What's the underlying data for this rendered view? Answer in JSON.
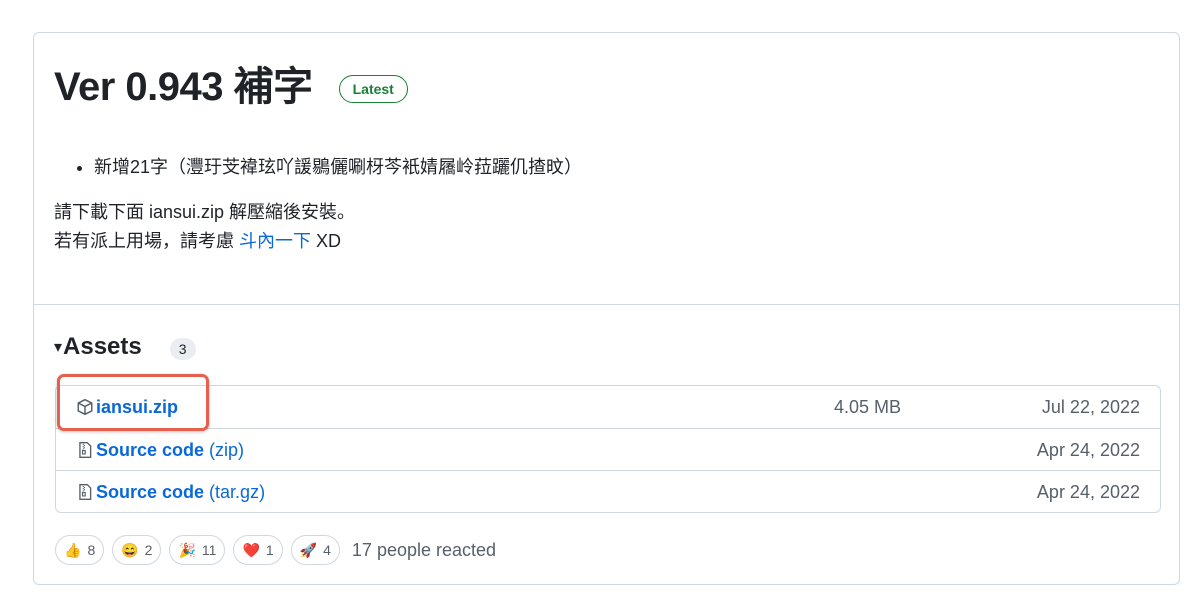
{
  "release": {
    "title": "Ver 0.943 補字",
    "badge": "Latest",
    "bullet": "新增21字（灃玗芠褘玹吖諼鶍儷唰枒芩衹婧屩岭菈躧仉揸旼）",
    "line1": "請下載下面 iansui.zip 解壓縮後安裝。",
    "line2_prefix": "若有派上用場，請考慮 ",
    "line2_link": "斗內一下",
    "line2_suffix": " XD"
  },
  "assets": {
    "title": "Assets",
    "count": "3",
    "items": [
      {
        "name": "iansui.zip",
        "suffix": "",
        "size": "4.05 MB",
        "date": "Jul 22, 2022",
        "icon": "package-icon"
      },
      {
        "name": "Source code",
        "suffix": "(zip)",
        "size": "",
        "date": "Apr 24, 2022",
        "icon": "file-zip-icon"
      },
      {
        "name": "Source code",
        "suffix": "(tar.gz)",
        "size": "",
        "date": "Apr 24, 2022",
        "icon": "file-zip-icon"
      }
    ]
  },
  "reactions": {
    "items": [
      {
        "emoji": "👍",
        "count": "8",
        "icon": "thumbs-up-icon"
      },
      {
        "emoji": "😄",
        "count": "2",
        "icon": "laugh-icon"
      },
      {
        "emoji": "🎉",
        "count": "11",
        "icon": "hooray-icon"
      },
      {
        "emoji": "❤️",
        "count": "1",
        "icon": "heart-icon"
      },
      {
        "emoji": "🚀",
        "count": "4",
        "icon": "rocket-icon"
      }
    ],
    "summary": "17 people reacted"
  },
  "colors": {
    "accent": "#0969da",
    "latest": "#1a7f37",
    "highlight": "#e5604d",
    "border": "#d0d7de"
  }
}
